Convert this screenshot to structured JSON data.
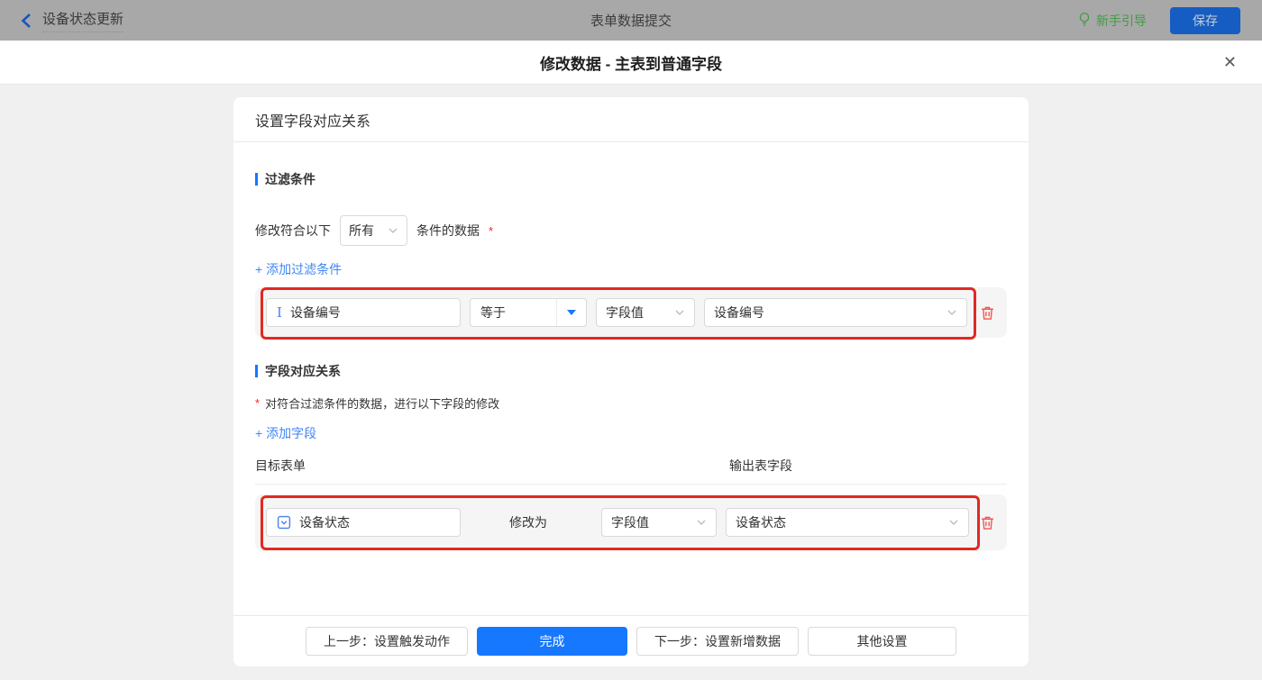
{
  "topbar": {
    "back_label": "设备状态更新",
    "center_title": "表单数据提交",
    "guide_label": "新手引导",
    "save_label": "保存"
  },
  "dialog": {
    "title": "修改数据 - 主表到普通字段",
    "close_icon": "✕"
  },
  "panel": {
    "title": "设置字段对应关系",
    "filter_section": {
      "heading": "过滤条件",
      "prefix": "修改符合以下",
      "match_select": "所有",
      "suffix": "条件的数据",
      "required_mark": "*",
      "add_link": "+ 添加过滤条件",
      "row": {
        "field": "设备编号",
        "operator": "等于",
        "value_type": "字段值",
        "value_field": "设备编号"
      }
    },
    "mapping_section": {
      "heading": "字段对应关系",
      "required_mark": "*",
      "description": "对符合过滤条件的数据，进行以下字段的修改",
      "add_link": "+ 添加字段",
      "col_target": "目标表单",
      "col_output": "输出表字段",
      "row": {
        "field": "设备状态",
        "middle_label": "修改为",
        "value_type": "字段值",
        "value_field": "设备状态"
      }
    },
    "footer": {
      "prev": "上一步：设置触发动作",
      "done": "完成",
      "next": "下一步：设置新增数据",
      "other": "其他设置"
    }
  },
  "colors": {
    "accent_blue": "#1677ff",
    "link_blue": "#4086f4",
    "highlight_red": "#e12a22",
    "trash_red": "#f2544f",
    "guide_green": "#3f9d43",
    "topbar_dimmed": "#a8a8a8",
    "page_background": "#f0f0f0"
  }
}
